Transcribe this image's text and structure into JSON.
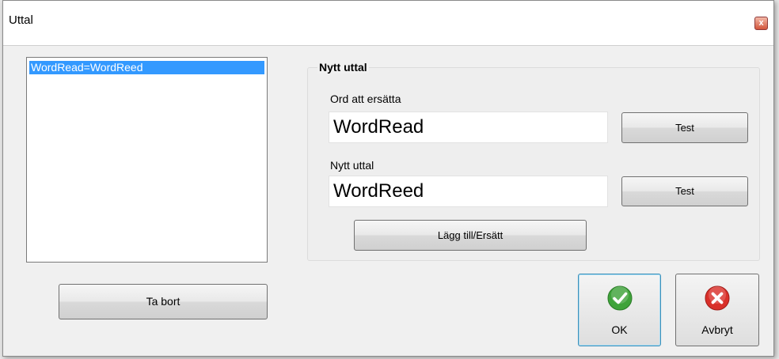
{
  "window": {
    "title": "Uttal",
    "close_glyph": "x"
  },
  "list": {
    "items": [
      "WordRead=WordReed"
    ]
  },
  "group": {
    "title": "Nytt uttal",
    "word_label": "Ord att ersätta",
    "word_value": "WordRead",
    "pron_label": "Nytt uttal",
    "pron_value": "WordReed",
    "test_label": "Test",
    "test2_label": "Test",
    "add_label": "Lägg till/Ersätt"
  },
  "buttons": {
    "remove_label": "Ta bort",
    "ok_label": "OK",
    "cancel_label": "Avbryt",
    "ok_icon": "checkmark-icon",
    "cancel_icon": "cancel-x-icon"
  },
  "colors": {
    "selection": "#3399ff",
    "ok_green": "#3fa33a",
    "cancel_red": "#d9302a"
  }
}
